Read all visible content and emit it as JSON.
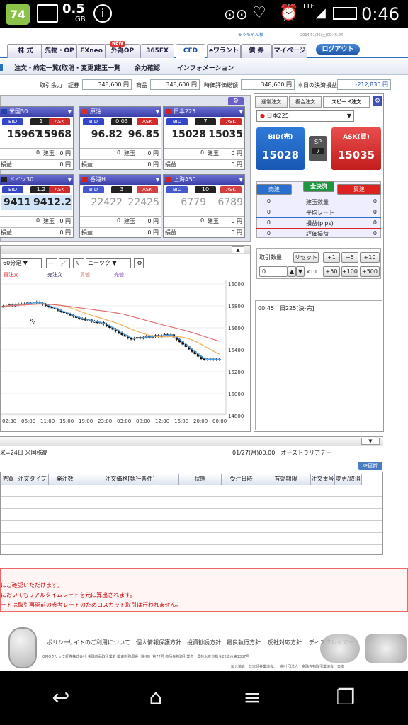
{
  "status_bar": {
    "battery_left": "74",
    "data_usage": "0.5",
    "data_unit": "GB",
    "network": "LTE",
    "time": "0:46"
  },
  "header": {
    "user": "そうちゃん様",
    "timestamp": "2014/01/25(土)00:45:24",
    "logout": "ログアウト"
  },
  "tabs": [
    "株 式",
    "先物・OP",
    "FXneo",
    "外為OP",
    "365FX",
    "CFD",
    "eワラント",
    "債 券",
    "マイページ"
  ],
  "new_badge": "NEW",
  "subnav": [
    "注文・約定一覧(取消・変更)",
    "建玉一覧",
    "余力確認",
    "インフォメーション"
  ],
  "margin": {
    "label": "取引余力",
    "sec_label": "証券",
    "sec_val": "348,600 円",
    "goods_label": "商品",
    "goods_val": "348,600 円",
    "eval_label": "時価評価総額",
    "eval_val": "348,600 円",
    "settle_label": "本日の決済損益",
    "settle_val": "-212,830 円"
  },
  "panes": [
    {
      "name": "米国30",
      "spread": "1",
      "bid": "15967",
      "ask": "15968",
      "qty": "0",
      "pos_label": "建玉",
      "amt": "0",
      "unit": "円",
      "pl_label": "損益",
      "pl_amt": "0",
      "pl_unit": "円"
    },
    {
      "name": "原油",
      "spread": "0.03",
      "bid": "96.82",
      "ask": "96.85",
      "qty": "0",
      "pos_label": "建玉",
      "amt": "0",
      "unit": "円",
      "pl_label": "損益",
      "pl_amt": "0",
      "pl_unit": "円"
    },
    {
      "name": "日本225",
      "spread": "7",
      "bid": "15028",
      "ask": "15035",
      "qty": "0",
      "pos_label": "建玉",
      "amt": "0",
      "unit": "円",
      "pl_label": "損益",
      "pl_amt": "0",
      "pl_unit": "円"
    },
    {
      "name": "ドイツ30",
      "spread": "1.2",
      "bid": "9411.0",
      "ask": "9412.2",
      "qty": "0",
      "pos_label": "建玉",
      "amt": "0",
      "unit": "円",
      "pl_label": "損益",
      "pl_amt": "0",
      "pl_unit": "円"
    },
    {
      "name": "香港H",
      "spread": "3",
      "bid": "22422",
      "ask": "22425",
      "qty": "0",
      "pos_label": "建玉",
      "amt": "0",
      "unit": "円",
      "pl_label": "損益",
      "pl_amt": "0",
      "pl_unit": "円"
    },
    {
      "name": "上海A50",
      "spread": "10",
      "bid": "6779",
      "ask": "6789",
      "qty": "0",
      "pos_label": "建玉",
      "amt": "0",
      "unit": "円",
      "pl_label": "損益",
      "pl_amt": "0",
      "pl_unit": "円"
    }
  ],
  "bid_label": "BID",
  "ask_label": "ASK",
  "chart": {
    "interval": "60分足",
    "tool": "ニーツク",
    "legend": [
      "買注文",
      "売注文",
      "買値",
      "売値"
    ],
    "y_ticks": [
      "16000",
      "15800",
      "15600",
      "15400",
      "15200",
      "15000",
      "14800"
    ],
    "x_ticks": [
      "02:30",
      "06:00",
      "11:00",
      "15:00",
      "19:00",
      "23:00",
      "03:00",
      "08:00",
      "12:00",
      "16:00",
      "20:00",
      "00:00"
    ]
  },
  "right_panel": {
    "tabs": [
      "通常注文",
      "複合注文",
      "スピード注文"
    ],
    "symbol": "日本225",
    "bid_title": "BID(売)",
    "bid_val": "15028",
    "ask_title": "ASK(買)",
    "ask_val": "15035",
    "sp_label": "SP",
    "sp_val": "7",
    "btn_sell": "売建",
    "btn_close": "全決済",
    "btn_buy": "買建",
    "rows": [
      {
        "l": "0",
        "m": "建玉数量",
        "r": "0"
      },
      {
        "l": "0",
        "m": "平均レート",
        "r": "0"
      },
      {
        "l": "0",
        "m": "損益(pips)",
        "r": "0"
      },
      {
        "l": "0",
        "m": "評価損益",
        "r": "0"
      }
    ],
    "qty_label": "取引数量",
    "reset": "リセット",
    "steps": [
      "+1",
      "+5",
      "+10",
      "+50",
      "+100",
      "+500"
    ],
    "qty_val": "0",
    "mult": "×10",
    "news": "00:45　日225[決-完]"
  },
  "ticker": {
    "left": "米=24日 米国株高",
    "right": "01/27(月)00:00　オーストラリアデー"
  },
  "update_btn": "更新",
  "table_headers": [
    "売買",
    "注文タイプ",
    "発注数",
    "注文価格[執行条件]",
    "状態",
    "受注日時",
    "有効期限",
    "注文番号",
    "変更/取消"
  ],
  "notices": [
    "にご確認いただけます。",
    "においてもリアルタイムレートを元に算出されます。",
    "ートは取引再開前の参考レートのためロスカット取引は行われません。"
  ],
  "footer": {
    "links": [
      "ポリシー",
      "サイトのご利用について",
      "個人情報保護方針",
      "投資勧誘方針",
      "最良執行方針",
      "反社対応方針",
      "ディスクレイマー"
    ],
    "company": "GMOクリック証券株式会社 金融商品取引業者 関東財務局長（金商）第77号 商品先物取引業者　農林水産省指令22総合第1337号",
    "assoc": "加入協会：日本証券業協会、一般社団法人　金融先物取引業協会　日本"
  }
}
